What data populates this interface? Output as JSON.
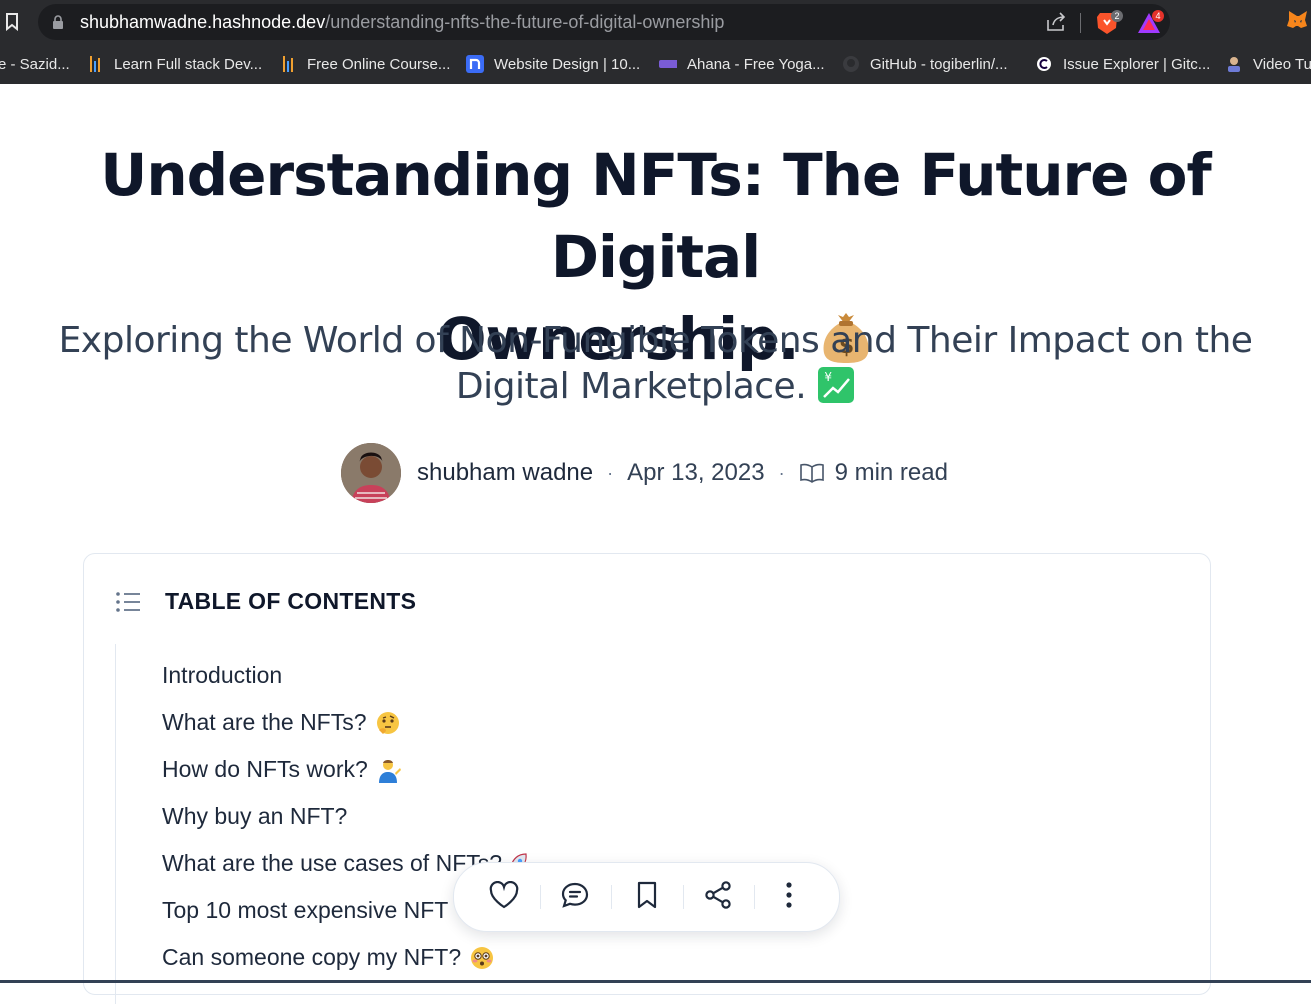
{
  "browser": {
    "url_host": "shubhamwadne.hashnode.dev",
    "url_path": "/understanding-nfts-the-future-of-digital-ownership",
    "brave_badge": "2",
    "rewards_badge": "4",
    "bookmarks": [
      {
        "label": "e - Sazid...",
        "icon": "none"
      },
      {
        "label": "Learn Full stack Dev...",
        "icon": "bars-icon"
      },
      {
        "label": "Free Online Course...",
        "icon": "bars-icon"
      },
      {
        "label": "Website Design | 10...",
        "icon": "n-icon"
      },
      {
        "label": "Ahana - Free Yoga...",
        "icon": "colorlib-icon"
      },
      {
        "label": "GitHub - togiberlin/...",
        "icon": "github-icon"
      },
      {
        "label": "Issue Explorer | Gitc...",
        "icon": "gitcoin-icon"
      },
      {
        "label": "Video Tu",
        "icon": "avatar-icon"
      }
    ]
  },
  "article": {
    "title_line1": "Understanding NFTs: The Future of Digital",
    "title_line2": "Ownership.",
    "subtitle_line1": "Exploring the World of Non-Fungible Tokens and Their Impact on the",
    "subtitle_line2": "Digital Marketplace.",
    "author": "shubham wadne",
    "date": "Apr 13, 2023",
    "read_time": "9 min read"
  },
  "toc": {
    "heading": "TABLE OF CONTENTS",
    "items": [
      {
        "label": "Introduction",
        "emoji": ""
      },
      {
        "label": "What are the NFTs?",
        "emoji": "thinking-face-icon"
      },
      {
        "label": "How do NFTs work?",
        "emoji": "person-tipping-hand-icon"
      },
      {
        "label": "Why buy an NFT?",
        "emoji": ""
      },
      {
        "label": "What are the use cases of NFTs?",
        "emoji": "rocket-icon"
      },
      {
        "label": "Top 10 most expensive NFT",
        "emoji": ""
      },
      {
        "label": "Can someone copy my NFT?",
        "emoji": "flushed-face-icon"
      }
    ]
  },
  "colors": {
    "chrome": "#2a2b2e",
    "title": "#0f172a",
    "subtitle": "#334155",
    "brave": "#fb542b"
  }
}
